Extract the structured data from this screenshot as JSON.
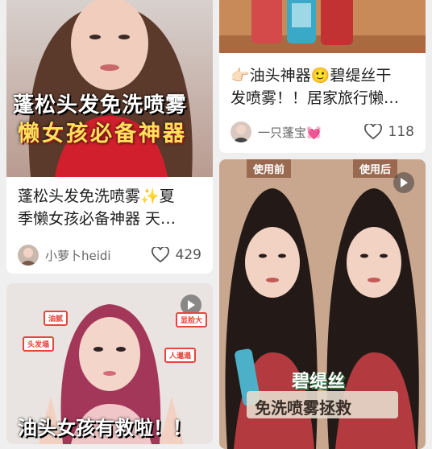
{
  "feed": {
    "cards": [
      {
        "overlay_line1": "蓬松头发免洗喷雾",
        "overlay_line2": "懒女孩必备神器",
        "title": "蓬松头发免洗喷雾✨夏\n季懒女孩必备神器 天…",
        "author": "小萝卜heidi",
        "likes": "429"
      },
      {
        "title": "👉🏻油头神器🙂碧缇丝干\n发喷雾！！居家旅行懒…",
        "author": "一只蓬宝💓",
        "likes": "118"
      },
      {
        "stickers": [
          "油腻",
          "显脸大",
          "头发塌",
          "人邋遢"
        ],
        "overlay_line1": "油头女孩有救啦！！"
      },
      {
        "banner_left": "使用前",
        "banner_right": "使用后",
        "brand": "碧缇丝",
        "caption": "免洗喷雾拯救"
      }
    ]
  },
  "colors": {
    "accent_red": "#d62c2c",
    "overlay_yellow": "#ffe15a",
    "heart_gray": "#555555"
  },
  "icons": {
    "like": "heart-outline-icon",
    "video": "play-icon"
  }
}
